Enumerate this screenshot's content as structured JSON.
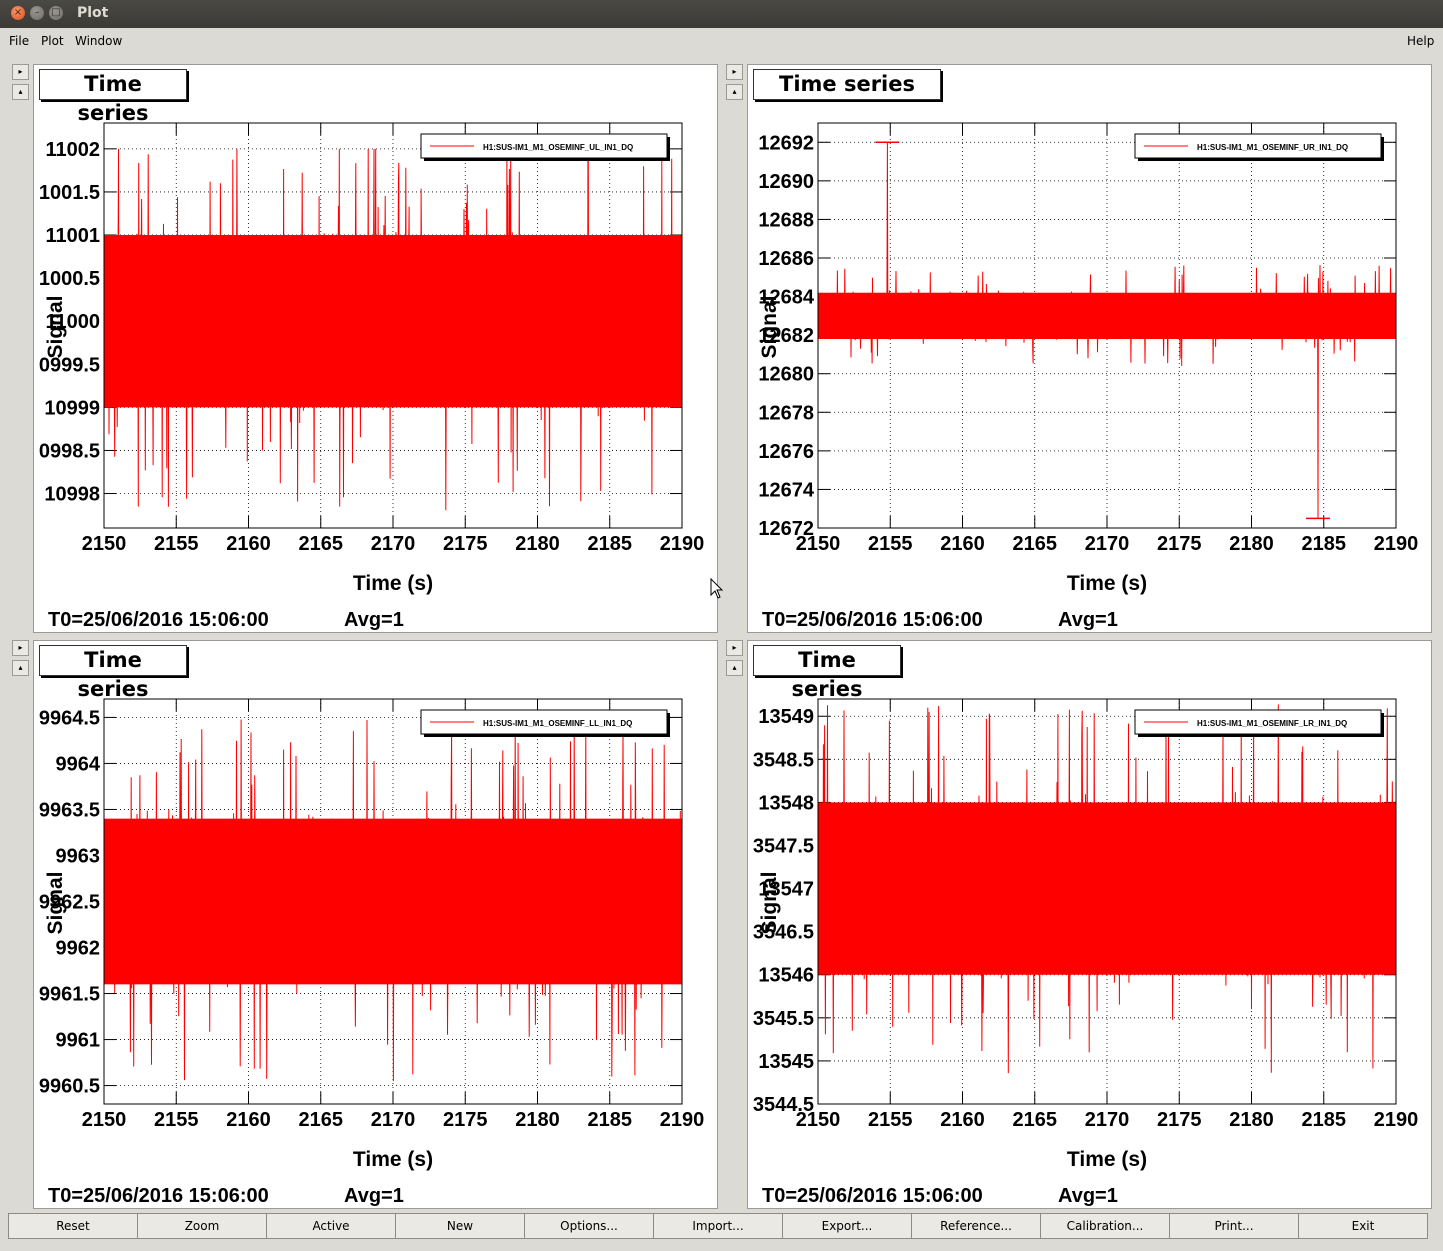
{
  "window": {
    "title": "Plot"
  },
  "menu": {
    "file": "File",
    "plot": "Plot",
    "window": "Window",
    "help": "Help"
  },
  "pads": [
    {
      "label": "Time series",
      "legend": "H1:SUS-IM1_M1_OSEMINF_UL_IN1_DQ",
      "t0": "T0=25/06/2016 15:06:00",
      "avg": "Avg=1",
      "xlabel": "Time (s)",
      "ylabel": "Signal",
      "xticks": [
        "2150",
        "2155",
        "2160",
        "2165",
        "2170",
        "2175",
        "2180",
        "2185",
        "2190"
      ],
      "yticks": [
        "11002",
        "1001.5",
        "11001",
        "1000.5",
        "11000",
        "0999.5",
        "10999",
        "0998.5",
        "10998"
      ]
    },
    {
      "label": "Time series",
      "legend": "H1:SUS-IM1_M1_OSEMINF_UR_IN1_DQ",
      "t0": "T0=25/06/2016 15:06:00",
      "avg": "Avg=1",
      "xlabel": "Time (s)",
      "ylabel": "Signal",
      "xticks": [
        "2150",
        "2155",
        "2160",
        "2165",
        "2170",
        "2175",
        "2180",
        "2185",
        "2190"
      ],
      "yticks": [
        "12692",
        "12690",
        "12688",
        "12686",
        "12684",
        "12682",
        "12680",
        "12678",
        "12676",
        "12674",
        "12672"
      ]
    },
    {
      "label": "Time series",
      "legend": "H1:SUS-IM1_M1_OSEMINF_LL_IN1_DQ",
      "t0": "T0=25/06/2016 15:06:00",
      "avg": "Avg=1",
      "xlabel": "Time (s)",
      "ylabel": "Signal",
      "xticks": [
        "2150",
        "2155",
        "2160",
        "2165",
        "2170",
        "2175",
        "2180",
        "2185",
        "2190"
      ],
      "yticks": [
        "9964.5",
        "9964",
        "9963.5",
        "9963",
        "9962.5",
        "9962",
        "9961.5",
        "9961",
        "9960.5"
      ]
    },
    {
      "label": "Time series",
      "legend": "H1:SUS-IM1_M1_OSEMINF_LR_IN1_DQ",
      "t0": "T0=25/06/2016 15:06:00",
      "avg": "Avg=1",
      "xlabel": "Time (s)",
      "ylabel": "Signal",
      "xticks": [
        "2150",
        "2155",
        "2160",
        "2165",
        "2170",
        "2175",
        "2180",
        "2185",
        "2190"
      ],
      "yticks": [
        "13549",
        "3548.5",
        "13548",
        "3547.5",
        "13547",
        "3546.5",
        "13546",
        "3545.5",
        "13545",
        "3544.5"
      ]
    }
  ],
  "chart_data": [
    {
      "type": "line",
      "title": "Time series",
      "xlabel": "Time (s)",
      "ylabel": "Signal",
      "xlim": [
        2150,
        2190
      ],
      "ylim": [
        10997.6,
        11002.3
      ],
      "grid": true,
      "legend_position": "top-right",
      "series": [
        {
          "name": "H1:SUS-IM1_M1_OSEMINF_UL_IN1_DQ",
          "color": "#ff0000",
          "center": 11000.0,
          "band_low": 10999.0,
          "band_high": 11001.0,
          "spike_max": 11002.0,
          "spike_min": 10997.6
        }
      ]
    },
    {
      "type": "line",
      "title": "Time series",
      "xlabel": "Time (s)",
      "ylabel": "Signal",
      "xlim": [
        2150,
        2190
      ],
      "ylim": [
        12672,
        12693
      ],
      "grid": true,
      "legend_position": "top-right",
      "series": [
        {
          "name": "H1:SUS-IM1_M1_OSEMINF_UR_IN1_DQ",
          "color": "#ff0000",
          "center": 12683.0,
          "band_low": 12681.8,
          "band_high": 12684.2,
          "spike_max": 12692.0,
          "spike_max_time": 2154.8,
          "spike_min": 12672.5,
          "spike_min_time": 2184.6
        }
      ]
    },
    {
      "type": "line",
      "title": "Time series",
      "xlabel": "Time (s)",
      "ylabel": "Signal",
      "xlim": [
        2150,
        2190
      ],
      "ylim": [
        9960.3,
        9964.7
      ],
      "grid": true,
      "legend_position": "top-right",
      "series": [
        {
          "name": "H1:SUS-IM1_M1_OSEMINF_LL_IN1_DQ",
          "color": "#ff0000",
          "center": 9962.5,
          "band_low": 9961.6,
          "band_high": 9963.4,
          "spike_max": 9964.6,
          "spike_min": 9960.4
        }
      ]
    },
    {
      "type": "line",
      "title": "Time series",
      "xlabel": "Time (s)",
      "ylabel": "Signal",
      "xlim": [
        2150,
        2190
      ],
      "ylim": [
        13544.5,
        13549.2
      ],
      "grid": true,
      "legend_position": "top-right",
      "series": [
        {
          "name": "H1:SUS-IM1_M1_OSEMINF_LR_IN1_DQ",
          "color": "#ff0000",
          "center": 13547.0,
          "band_low": 13546.0,
          "band_high": 13548.0,
          "spike_max": 13549.2,
          "spike_min": 13544.7
        }
      ]
    }
  ],
  "buttons": [
    "Reset",
    "Zoom",
    "Active",
    "New",
    "Options...",
    "Import...",
    "Export...",
    "Reference...",
    "Calibration...",
    "Print...",
    "Exit"
  ]
}
